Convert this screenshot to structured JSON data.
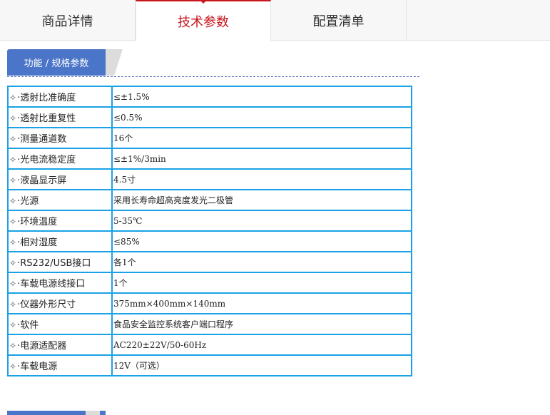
{
  "tabs": [
    {
      "label": "商品详情",
      "active": false
    },
    {
      "label": "技术参数",
      "active": true
    },
    {
      "label": "配置清单",
      "active": false
    }
  ],
  "section": {
    "title": "功能 / 规格参数"
  },
  "colors": {
    "accent": "#c8161d",
    "section_bg": "#4b75c9",
    "table_border": "#1aa1e6"
  },
  "bullet_icon": "diamond-star-icon",
  "bullet": "✧",
  "specs": [
    {
      "key": "·透射比准确度",
      "value": "≤±1.5%"
    },
    {
      "key": "·透射比重复性",
      "value": "≤0.5%"
    },
    {
      "key": "·测量通道数",
      "value": "16个"
    },
    {
      "key": "·光电流稳定度",
      "value": "≤±1%/3min"
    },
    {
      "key": "·液晶显示屏",
      "value": "4.5寸"
    },
    {
      "key": "·光源",
      "value": "采用长寿命超高亮度发光二极管"
    },
    {
      "key": "·环境温度",
      "value": "5-35℃"
    },
    {
      "key": "·相对湿度",
      "value": "≤85%"
    },
    {
      "key": "·RS232/USB接口",
      "value": "各1个"
    },
    {
      "key": "·车载电源线接口",
      "value": "1个"
    },
    {
      "key": "·仪器外形尺寸",
      "value": "375mm×400mm×140mm"
    },
    {
      "key": "·软件",
      "value": "食品安全监控系统客户端口程序"
    },
    {
      "key": "·电源适配器",
      "value": "AC220±22V/50-60Hz"
    },
    {
      "key": "·车载电源",
      "value": "12V（可选）"
    }
  ]
}
